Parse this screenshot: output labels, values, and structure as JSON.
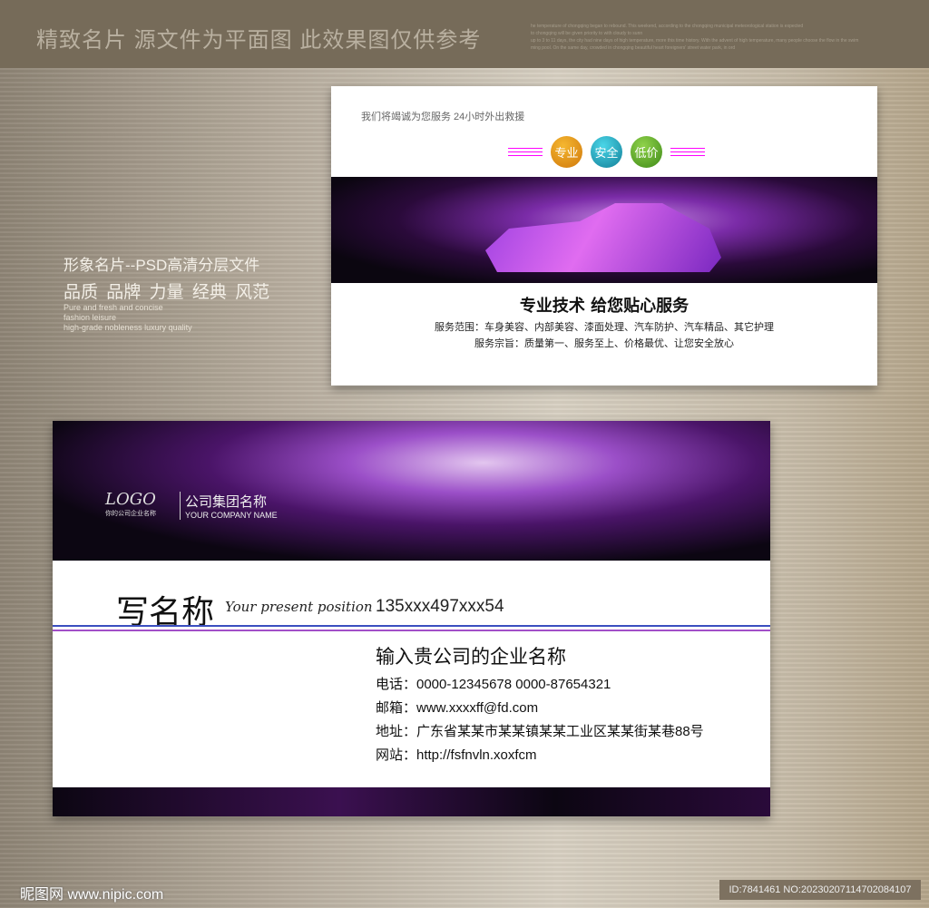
{
  "header": {
    "title": "精致名片 源文件为平面图 此效果图仅供参考",
    "filler_text": [
      "he temperature of chongqing began to rebound. This weekend, according to the chongqing municipal meteorological station is expected",
      "to chongqing will be given priority to with cloudy to sunn",
      "up to 3 to 11 days, the city had nine days of high temperature, more this time history. With the advent of high temperature, many people choose the flow in the swim",
      "ming pool. On the same day, crowded in chongqing beautiful heart foreigners' street water park, in ord"
    ]
  },
  "side": {
    "line1": "形象名片--PSD高清分层文件",
    "line2": "品质 品牌 力量 经典 风范",
    "en": [
      "Pure and fresh and concise",
      "fashion leisure",
      "high-grade nobleness luxury quality"
    ]
  },
  "back_card": {
    "tagline": "我们将竭诚为您服务 24小时外出救援",
    "badges": [
      {
        "label": "专业",
        "color": "#e0901a"
      },
      {
        "label": "安全",
        "color": "#22a6c0"
      },
      {
        "label": "低价",
        "color": "#5aa82a"
      }
    ],
    "headline": "专业技术 给您贴心服务",
    "scope": "服务范围：车身美容、内部美容、漆面处理、汽车防护、汽车精品、其它护理",
    "tenet": "服务宗旨：质量第一、服务至上、价格最优、让您安全放心"
  },
  "front_card": {
    "logo": "LOGO",
    "logo_sub": "你的公司企业名称",
    "company_zh": "公司集团名称",
    "company_en": "YOUR COMPANY NAME",
    "name": "写名称",
    "position": "Your present position",
    "phone": "135xxx497xxx54",
    "company": "输入贵公司的企业名称",
    "info": [
      "电话：0000-12345678  0000-87654321",
      "邮箱：www.xxxxff@fd.com",
      "地址：广东省某某市某某镇某某工业区某某街某巷88号",
      "网站：http://fsfnvln.xoxfcm"
    ]
  },
  "footer": {
    "watermark": "昵图网 www.nipic.com",
    "id": "ID:7841461 NO:20230207114702084107"
  }
}
